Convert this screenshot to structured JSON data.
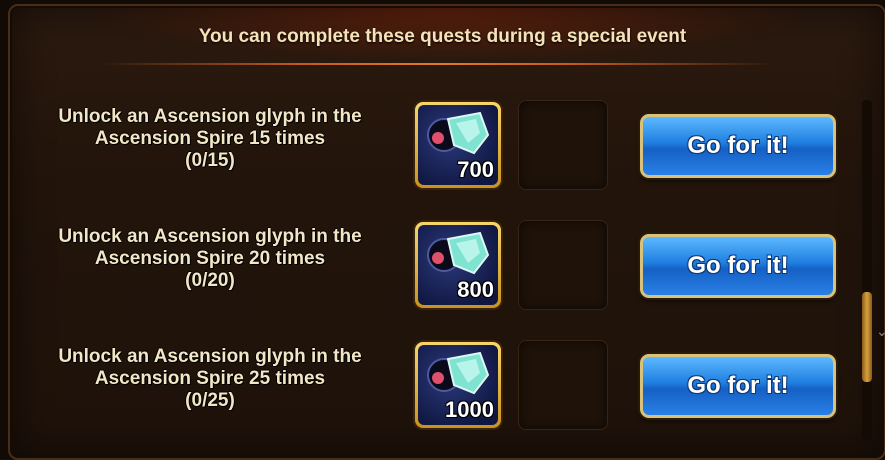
{
  "header": {
    "title": "You can complete these quests during a special event"
  },
  "quests": [
    {
      "line1": "Unlock an Ascension glyph in the",
      "line2": "Ascension Spire 15 times",
      "progress": "(0/15)",
      "reward_amount": "700",
      "button_label": "Go for it!"
    },
    {
      "line1": "Unlock an Ascension glyph in the",
      "line2": "Ascension Spire 20 times",
      "progress": "(0/20)",
      "reward_amount": "800",
      "button_label": "Go for it!"
    },
    {
      "line1": "Unlock an Ascension glyph in the",
      "line2": "Ascension Spire 25 times",
      "progress": "(0/25)",
      "reward_amount": "1000",
      "button_label": "Go for it!"
    }
  ],
  "icons": {
    "reward": "ascension-glyph-icon",
    "scroll": "chevron-down-icon"
  },
  "colors": {
    "button_blue": "#1f7ee0",
    "gold_frame": "#f7d66a",
    "header_text": "#f6e2b8"
  }
}
